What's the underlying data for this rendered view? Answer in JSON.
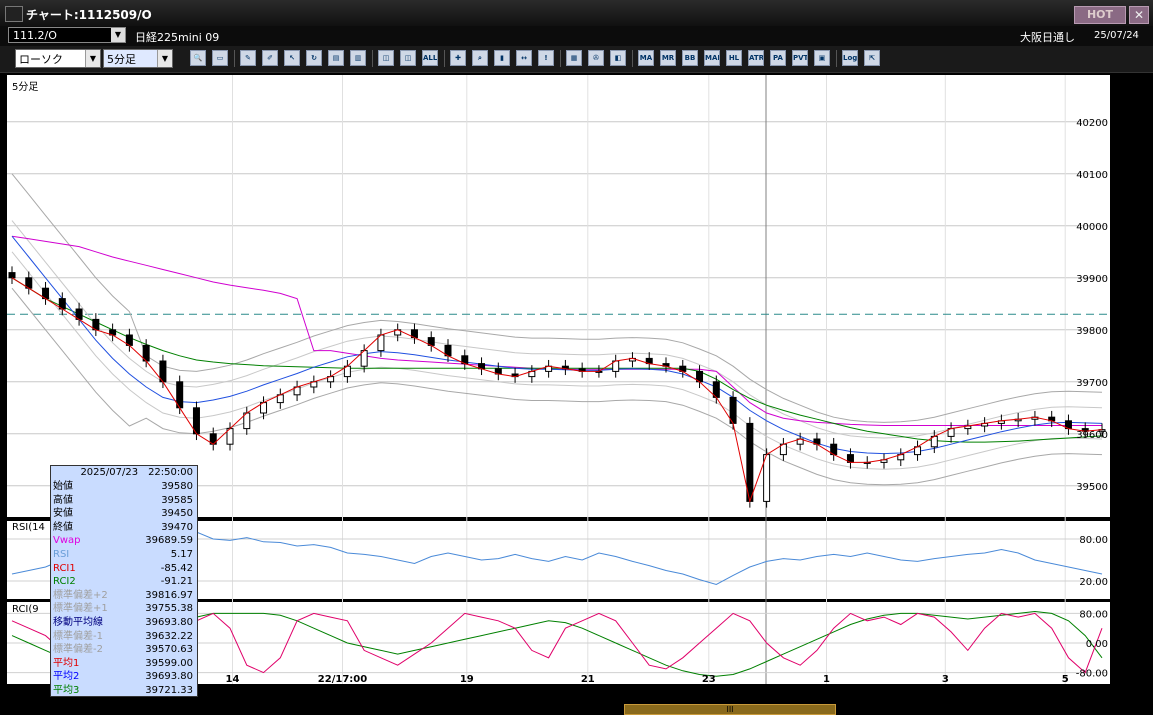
{
  "window": {
    "title": "チャート:1112509/O",
    "hot_label": "HOT",
    "close_label": "✕"
  },
  "header": {
    "code": "111.2/O",
    "instrument": "日経225mini 09",
    "source": "大阪日通し",
    "date": "25/07/24"
  },
  "toolbar": {
    "chart_type": "ローソク",
    "interval": "5分足",
    "buttons": [
      {
        "name": "zoom-icon",
        "glyph": "🔍"
      },
      {
        "name": "window-icon",
        "glyph": "▭"
      },
      {
        "name": "pen-icon",
        "glyph": "✎"
      },
      {
        "name": "brush-icon",
        "glyph": "✐"
      },
      {
        "name": "cursor-icon",
        "glyph": "↖"
      },
      {
        "name": "refresh-icon",
        "glyph": "↻"
      },
      {
        "name": "document-icon",
        "glyph": "▤"
      },
      {
        "name": "trash-icon",
        "glyph": "▥"
      },
      {
        "name": "candle-in-icon",
        "glyph": "◫"
      },
      {
        "name": "candle-out-icon",
        "glyph": "◫"
      },
      {
        "name": "all-icon",
        "glyph": "ALL"
      },
      {
        "name": "crosshair-icon",
        "glyph": "✚"
      },
      {
        "name": "search-chart-icon",
        "glyph": "⌕"
      },
      {
        "name": "bar-chart-icon",
        "glyph": "▮"
      },
      {
        "name": "arrows-icon",
        "glyph": "↔"
      },
      {
        "name": "info-icon",
        "glyph": "!"
      },
      {
        "name": "grid-icon",
        "glyph": "▦"
      },
      {
        "name": "wrench-icon",
        "glyph": "✇"
      },
      {
        "name": "palette-icon",
        "glyph": "◧"
      },
      {
        "name": "indicator-ma-icon",
        "glyph": "MA"
      },
      {
        "name": "indicator-mr-icon",
        "glyph": "MR"
      },
      {
        "name": "indicator-bb-icon",
        "glyph": "BB"
      },
      {
        "name": "indicator-mae-icon",
        "glyph": "MAE"
      },
      {
        "name": "indicator-hl-icon",
        "glyph": "HL"
      },
      {
        "name": "indicator-atr-icon",
        "glyph": "ATR"
      },
      {
        "name": "indicator-pa-icon",
        "glyph": "PA"
      },
      {
        "name": "indicator-pvt-icon",
        "glyph": "PVT"
      },
      {
        "name": "frame-icon",
        "glyph": "▣"
      },
      {
        "name": "log-icon",
        "glyph": "Log"
      },
      {
        "name": "export-icon",
        "glyph": "⇱"
      }
    ]
  },
  "chart_data": {
    "type": "line",
    "panels": [
      "price",
      "rsi",
      "rci"
    ],
    "main_label": "5分足",
    "rsi_label": "RSI(14",
    "rci_label": "RCI(9",
    "price_axis": {
      "ticks": [
        39500,
        39600,
        39700,
        39800,
        39900,
        40000,
        40100,
        40200
      ],
      "ylim": [
        39440,
        40290
      ]
    },
    "rsi_axis": {
      "ticks": [
        "80.00",
        "20.00"
      ]
    },
    "rci_axis": {
      "ticks": [
        "80.00",
        "0.00",
        "-80.00"
      ]
    },
    "x_tick_labels": [
      "14",
      "22/17:00",
      "19",
      "21",
      "23",
      "1",
      "3",
      "5"
    ],
    "dashed_level": 39830,
    "close": [
      39900,
      39880,
      39860,
      39840,
      39820,
      39800,
      39790,
      39770,
      39740,
      39700,
      39650,
      39600,
      39580,
      39610,
      39640,
      39660,
      39675,
      39690,
      39700,
      39710,
      39730,
      39760,
      39790,
      39800,
      39785,
      39770,
      39750,
      39735,
      39725,
      39715,
      39710,
      39720,
      39730,
      39725,
      39720,
      39720,
      39740,
      39745,
      39735,
      39730,
      39720,
      39700,
      39670,
      39620,
      39470,
      39560,
      39580,
      39590,
      39580,
      39560,
      39545,
      39545,
      39550,
      39560,
      39575,
      39595,
      39610,
      39615,
      39620,
      39625,
      39628,
      39632,
      39625,
      39610,
      39605,
      39608
    ],
    "ma_blue": [
      39980,
      39940,
      39900,
      39860,
      39820,
      39780,
      39745,
      39715,
      39690,
      39670,
      39662,
      39660,
      39665,
      39672,
      39682,
      39694,
      39705,
      39716,
      39728,
      39738,
      39748,
      39754,
      39758,
      39756,
      39752,
      39747,
      39742,
      39738,
      39734,
      39730,
      39726,
      39724,
      39724,
      39723,
      39722,
      39722,
      39724,
      39725,
      39724,
      39722,
      39715,
      39703,
      39690,
      39670,
      39645,
      39625,
      39608,
      39595,
      39582,
      39572,
      39566,
      39563,
      39562,
      39563,
      39566,
      39572,
      39580,
      39588,
      39596,
      39604,
      39611,
      39617,
      39621,
      39622,
      39621,
      39620
    ],
    "ma_green": [
      39900,
      39880,
      39860,
      39845,
      39830,
      39815,
      39800,
      39785,
      39772,
      39760,
      39750,
      39742,
      39738,
      39735,
      39733,
      39731,
      39730,
      39729,
      39728,
      39727,
      39726,
      39726,
      39726,
      39726,
      39726,
      39726,
      39726,
      39726,
      39726,
      39726,
      39726,
      39726,
      39726,
      39726,
      39726,
      39726,
      39726,
      39726,
      39726,
      39726,
      39726,
      39720,
      39705,
      39685,
      39668,
      39655,
      39645,
      39636,
      39628,
      39620,
      39612,
      39605,
      39600,
      39595,
      39590,
      39587,
      39585,
      39584,
      39584,
      39585,
      39586,
      39588,
      39590,
      39592,
      39594,
      39596
    ],
    "ma_magenta": [
      39980,
      39975,
      39970,
      39965,
      39960,
      39950,
      39940,
      39932,
      39924,
      39916,
      39908,
      39900,
      39892,
      39886,
      39881,
      39876,
      39870,
      39860,
      39760,
      39760,
      39755,
      39750,
      39745,
      39742,
      39740,
      39738,
      39736,
      39734,
      39732,
      39730,
      39728,
      39726,
      39724,
      39724,
      39724,
      39724,
      39724,
      39724,
      39724,
      39724,
      39724,
      39724,
      39720,
      39690,
      39660,
      39640,
      39630,
      39625,
      39622,
      39620,
      39618,
      39617,
      39616,
      39616,
      39616,
      39616,
      39616,
      39616,
      39616,
      39616,
      39616,
      39616,
      39616,
      39616,
      39616,
      39616
    ],
    "rsi": [
      30,
      35,
      40,
      50,
      55,
      60,
      55,
      60,
      65,
      70,
      80,
      90,
      80,
      78,
      82,
      76,
      75,
      70,
      72,
      68,
      60,
      58,
      55,
      50,
      45,
      55,
      60,
      55,
      50,
      52,
      58,
      52,
      48,
      55,
      50,
      60,
      55,
      48,
      42,
      35,
      30,
      22,
      15,
      28,
      40,
      48,
      52,
      50,
      55,
      58,
      55,
      60,
      55,
      50,
      48,
      52,
      55,
      58,
      60,
      65,
      60,
      50,
      45,
      40,
      35,
      30
    ],
    "rci1": [
      60,
      40,
      20,
      -20,
      40,
      80,
      85,
      80,
      75,
      80,
      70,
      60,
      80,
      40,
      -60,
      -80,
      -40,
      60,
      80,
      70,
      60,
      -20,
      -40,
      -60,
      -30,
      0,
      40,
      80,
      70,
      60,
      40,
      -20,
      -40,
      40,
      60,
      80,
      60,
      0,
      -60,
      -70,
      -40,
      0,
      40,
      80,
      60,
      0,
      -40,
      -60,
      -20,
      40,
      80,
      60,
      70,
      50,
      80,
      70,
      30,
      -20,
      40,
      80,
      70,
      80,
      40,
      -40,
      -80,
      40
    ],
    "rci2": [
      20,
      0,
      -20,
      -40,
      -60,
      -70,
      -60,
      -40,
      -10,
      20,
      50,
      70,
      80,
      80,
      80,
      80,
      75,
      60,
      40,
      20,
      0,
      -10,
      -20,
      -30,
      -20,
      -10,
      0,
      10,
      20,
      30,
      40,
      50,
      60,
      55,
      40,
      20,
      0,
      -20,
      -40,
      -60,
      -75,
      -85,
      -90,
      -85,
      -70,
      -50,
      -30,
      -10,
      10,
      30,
      50,
      65,
      75,
      80,
      80,
      75,
      70,
      65,
      70,
      75,
      80,
      85,
      80,
      60,
      20,
      -40
    ]
  },
  "info_panel": {
    "datetime": "2025/07/23　22:50:00",
    "rows": [
      {
        "label": "始値",
        "value": "39580",
        "color": "#000000"
      },
      {
        "label": "高値",
        "value": "39585",
        "color": "#000000"
      },
      {
        "label": "安値",
        "value": "39450",
        "color": "#000000"
      },
      {
        "label": "終値",
        "value": "39470",
        "color": "#000000"
      },
      {
        "label": "Vwap",
        "value": "39689.59",
        "color": "#e000e0"
      },
      {
        "label": "RSI",
        "value": "5.17",
        "color": "#6a9ed8"
      },
      {
        "label": "RCI1",
        "value": "-85.42",
        "color": "#e00000"
      },
      {
        "label": "RCI2",
        "value": "-91.21",
        "color": "#008000"
      },
      {
        "label": "標準偏差+2",
        "value": "39816.97",
        "color": "#a0a0a0"
      },
      {
        "label": "標準偏差+1",
        "value": "39755.38",
        "color": "#a0a0a0"
      },
      {
        "label": "移動平均線",
        "value": "39693.80",
        "color": "#000080"
      },
      {
        "label": "標準偏差-1",
        "value": "39632.22",
        "color": "#a0a0a0"
      },
      {
        "label": "標準偏差-2",
        "value": "39570.63",
        "color": "#a0a0a0"
      },
      {
        "label": "平均1",
        "value": "39599.00",
        "color": "#e00000"
      },
      {
        "label": "平均2",
        "value": "39693.80",
        "color": "#0000ff"
      },
      {
        "label": "平均3",
        "value": "39721.33",
        "color": "#008000"
      }
    ]
  },
  "statusbar": {
    "thumb_label": "III"
  }
}
